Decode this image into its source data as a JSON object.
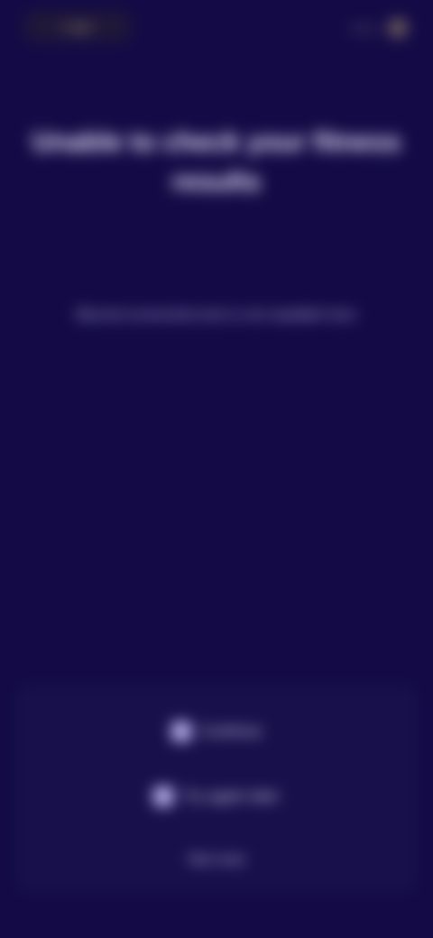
{
  "topbar": {
    "logo_text": "Logo",
    "right_label": "Menu",
    "right_icon": "circle-icon"
  },
  "hero": {
    "headline": "Unable to check your fitness results",
    "subtext": "Blurred screenshot text is not readable here"
  },
  "footer": {
    "primary_label": "Continue",
    "secondary_label": "Try again later",
    "tertiary_label": "Not now"
  },
  "colors": {
    "background": "#140b46",
    "text_primary": "#ede8ff",
    "text_secondary": "#bdb4e6",
    "accent_icon": "#bcb3ee"
  }
}
